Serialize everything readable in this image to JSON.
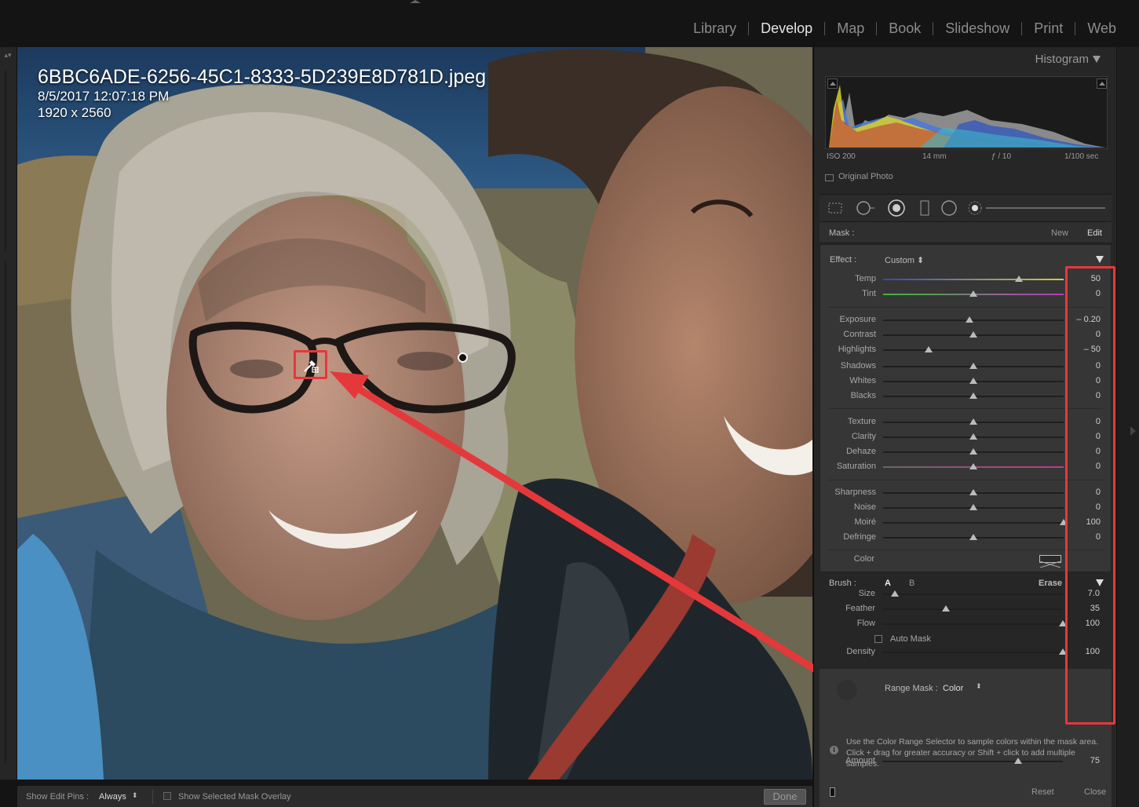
{
  "modules": [
    {
      "label": "Library",
      "active": false
    },
    {
      "label": "Develop",
      "active": true
    },
    {
      "label": "Map",
      "active": false
    },
    {
      "label": "Book",
      "active": false
    },
    {
      "label": "Slideshow",
      "active": false
    },
    {
      "label": "Print",
      "active": false
    },
    {
      "label": "Web",
      "active": false
    }
  ],
  "photo": {
    "filename": "6BBC6ADE-6256-45C1-8333-5D239E8D781D.jpeg",
    "date": "8/5/2017 12:07:18 PM",
    "dimensions": "1920 x 2560"
  },
  "histogram": {
    "title": "Histogram",
    "iso": "ISO 200",
    "focal": "14 mm",
    "aperture": "ƒ / 10",
    "shutter": "1/100 sec",
    "original_photo_label": "Original Photo",
    "original_photo_checked": false
  },
  "mask": {
    "label": "Mask :",
    "new_label": "New",
    "edit_label": "Edit"
  },
  "effect": {
    "label": "Effect :",
    "preset": "Custom"
  },
  "sliders": [
    {
      "label": "Temp",
      "value": "50",
      "pos": 0.75,
      "track": "temp"
    },
    {
      "label": "Tint",
      "value": "0",
      "pos": 0.5,
      "track": "tint"
    },
    {
      "label": "Exposure",
      "value": "– 0.20",
      "pos": 0.48
    },
    {
      "label": "Contrast",
      "value": "0",
      "pos": 0.5
    },
    {
      "label": "Highlights",
      "value": "– 50",
      "pos": 0.25
    },
    {
      "label": "Shadows",
      "value": "0",
      "pos": 0.5
    },
    {
      "label": "Whites",
      "value": "0",
      "pos": 0.5
    },
    {
      "label": "Blacks",
      "value": "0",
      "pos": 0.5
    },
    {
      "label": "Texture",
      "value": "0",
      "pos": 0.5
    },
    {
      "label": "Clarity",
      "value": "0",
      "pos": 0.5
    },
    {
      "label": "Dehaze",
      "value": "0",
      "pos": 0.5
    },
    {
      "label": "Saturation",
      "value": "0",
      "pos": 0.5,
      "track": "sat"
    },
    {
      "label": "Sharpness",
      "value": "0",
      "pos": 0.5
    },
    {
      "label": "Noise",
      "value": "0",
      "pos": 0.5
    },
    {
      "label": "Moiré",
      "value": "100",
      "pos": 1.0
    },
    {
      "label": "Defringe",
      "value": "0",
      "pos": 0.5
    }
  ],
  "color_label": "Color",
  "brush": {
    "label": "Brush :",
    "a": "A",
    "b": "B",
    "erase": "Erase",
    "sliders": [
      {
        "label": "Size",
        "value": "7.0",
        "pos": 0.07
      },
      {
        "label": "Feather",
        "value": "35",
        "pos": 0.35
      },
      {
        "label": "Flow",
        "value": "100",
        "pos": 1.0
      },
      {
        "label": "Density",
        "value": "100",
        "pos": 1.0
      }
    ],
    "auto_mask_label": "Auto Mask",
    "auto_mask_checked": false
  },
  "range_mask": {
    "label": "Range Mask :",
    "value": "Color",
    "amount_label": "Amount",
    "amount_value": "75",
    "amount_pos": 0.75,
    "help": "Use the Color Range Selector to sample colors within the mask area. Click + drag for greater accuracy or Shift + click to add multiple samples."
  },
  "footer": {
    "reset": "Reset",
    "close": "Close"
  },
  "bottom_toolbar": {
    "show_edit_pins_label": "Show Edit Pins :",
    "show_edit_pins_value": "Always",
    "show_overlay_label": "Show Selected Mask Overlay",
    "show_overlay_checked": false,
    "done_label": "Done"
  },
  "colors": {
    "annotation": "#e5383b",
    "panel": "#262626",
    "panel_active": "#363636"
  }
}
